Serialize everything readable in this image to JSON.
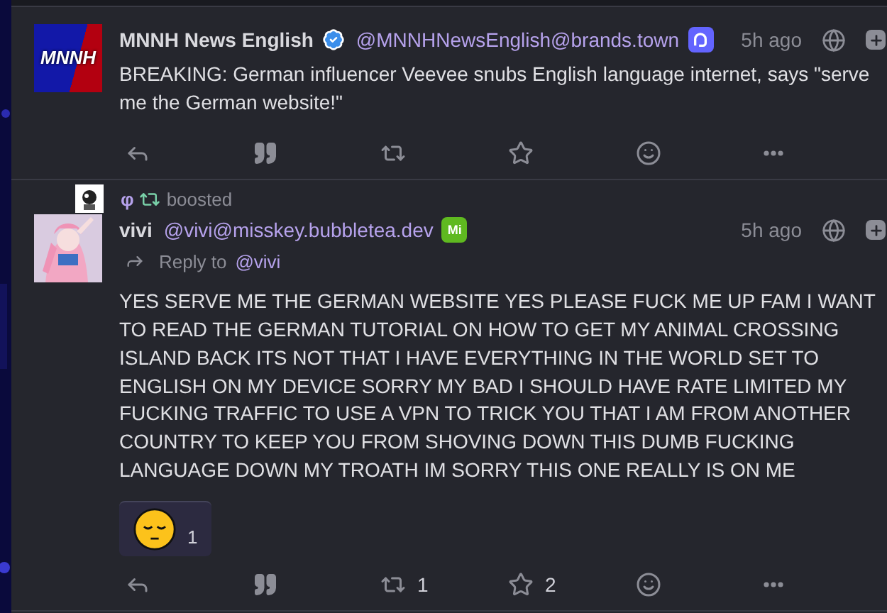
{
  "posts": [
    {
      "avatar": {
        "kind": "logo",
        "text": "MNNH"
      },
      "name": "MNNH News English",
      "verified": true,
      "handle": "@MNNHNewsEnglish@brands.town",
      "software": {
        "kind": "mastodon"
      },
      "time": "5h ago",
      "body": "BREAKING: German influencer Veevee snubs English language internet, says \"serve me the German website!\"",
      "actions": [
        {
          "kind": "reply"
        },
        {
          "kind": "quote"
        },
        {
          "kind": "boost"
        },
        {
          "kind": "favourite"
        },
        {
          "kind": "emoji"
        },
        {
          "kind": "more"
        }
      ]
    },
    {
      "boost": {
        "name": "φ",
        "label": "boosted"
      },
      "avatar": {
        "kind": "picture"
      },
      "name": "vivi",
      "verified": false,
      "handle": "@vivi@misskey.bubbletea.dev",
      "software": {
        "kind": "misskey",
        "text": "Mi"
      },
      "time": "5h ago",
      "reply_to": {
        "label": "Reply to",
        "handle": "@vivi"
      },
      "body": "YES SERVE ME THE GERMAN WEBSITE YES PLEASE FUCK ME UP FAM I WANT TO READ THE GERMAN TUTORIAL ON HOW TO GET MY ANIMAL CROSSING ISLAND BACK ITS NOT THAT I HAVE EVERYTHING IN THE WORLD SET TO ENGLISH ON MY DEVICE SORRY MY BAD I SHOULD HAVE RATE LIMITED MY FUCKING TRAFFIC TO USE A VPN TO TRICK YOU THAT I AM FROM ANOTHER COUNTRY TO KEEP YOU FROM SHOVING DOWN THIS DUMB FUCKING LANGUAGE DOWN MY TROATH IM SORRY THIS ONE REALLY IS ON ME",
      "reactions": [
        {
          "kind": "pensive",
          "count": "1"
        }
      ],
      "actions": [
        {
          "kind": "reply"
        },
        {
          "kind": "quote"
        },
        {
          "kind": "boost",
          "count": "1"
        },
        {
          "kind": "favourite",
          "count": "2"
        },
        {
          "kind": "emoji"
        },
        {
          "kind": "more"
        }
      ]
    }
  ]
}
